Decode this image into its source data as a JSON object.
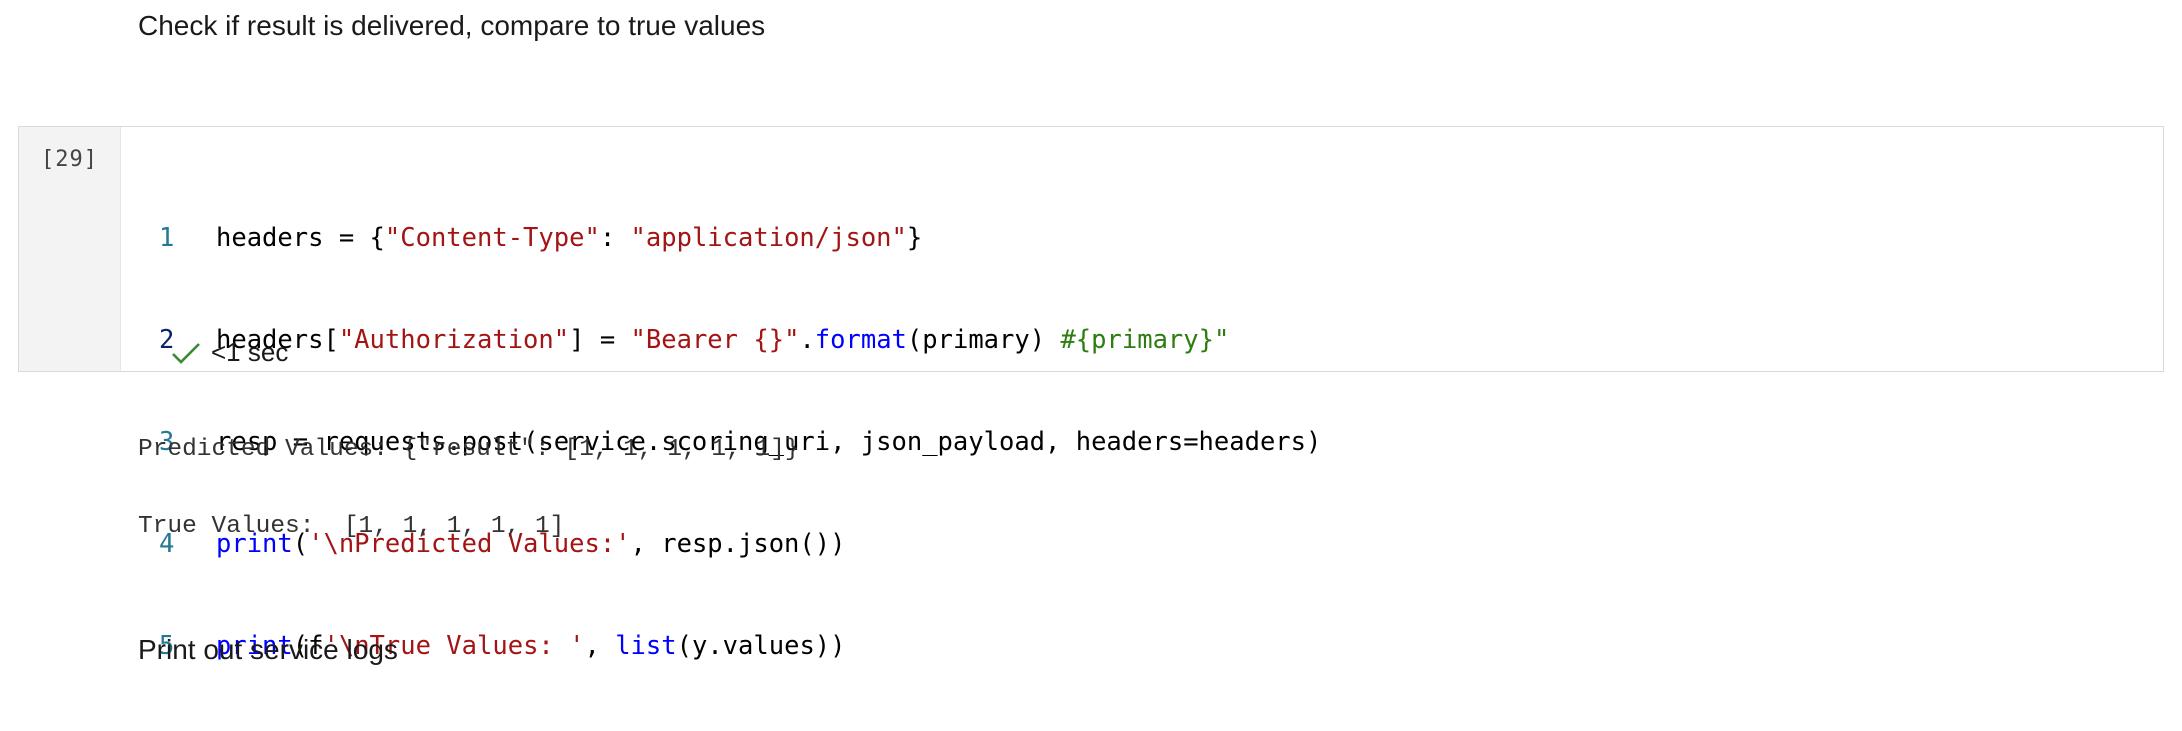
{
  "markdown_top": "Check if result is delivered, compare to true values",
  "markdown_bottom": "Print out service logs",
  "cell": {
    "execution_count": "[29]",
    "status_time": "<1 sec",
    "status_icon": "check-icon",
    "code_lines": [
      {
        "number": "1"
      },
      {
        "number": "2"
      },
      {
        "number": "3"
      },
      {
        "number": "4"
      },
      {
        "number": "5"
      }
    ],
    "tokens": {
      "l1_a": "headers = {",
      "l1_b": "\"Content-Type\"",
      "l1_c": ": ",
      "l1_d": "\"application/json\"",
      "l1_e": "}",
      "l2_a": "headers[",
      "l2_b": "\"Authorization\"",
      "l2_c": "] = ",
      "l2_d": "\"Bearer {}\"",
      "l2_e": ".",
      "l2_f": "format",
      "l2_g": "(primary) ",
      "l2_h": "#{primary}\"",
      "l3_a": "resp = requests.post(service.scoring_uri, json_payload, headers=headers)",
      "l4_a": "print",
      "l4_b": "(",
      "l4_c": "'\\nPredicted Values:'",
      "l4_d": ", resp.json())",
      "l5_a": "print",
      "l5_b": "(f",
      "l5_c": "'\\nTrue Values: '",
      "l5_d": ", ",
      "l5_e": "list",
      "l5_f": "(y.values))"
    }
  },
  "output": {
    "line1": "Predicted Values: {\"result\": [1, 1, 1, 1, 1]}",
    "line2": "True Values:  [1, 1, 1, 1, 1]"
  },
  "colors": {
    "string": "#a31515",
    "keyword": "#0000ff",
    "comment": "#2d7d0f",
    "line_number": "#237893",
    "success": "#388a34"
  }
}
